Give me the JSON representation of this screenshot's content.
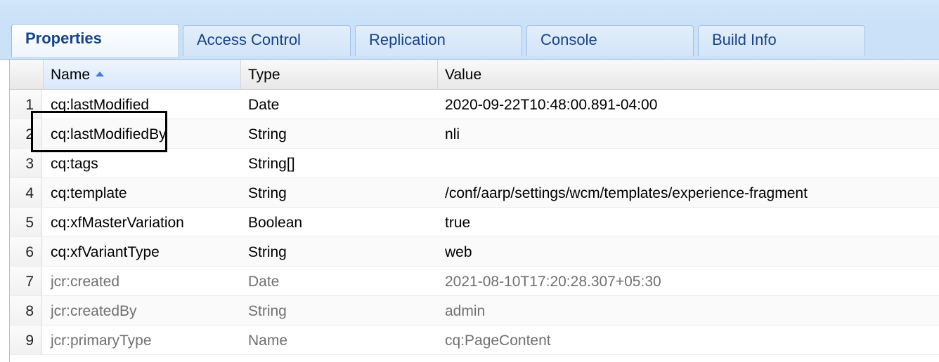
{
  "tabs": [
    {
      "label": "Properties",
      "active": true
    },
    {
      "label": "Access Control",
      "active": false
    },
    {
      "label": "Replication",
      "active": false
    },
    {
      "label": "Console",
      "active": false
    },
    {
      "label": "Build Info",
      "active": false
    }
  ],
  "columns": {
    "name": "Name",
    "type": "Type",
    "value": "Value",
    "sort_column": "Name",
    "sort_direction": "ascending"
  },
  "rows": [
    {
      "num": "1",
      "name": "cq:lastModified",
      "type": "Date",
      "value": "2020-09-22T10:48:00.891-04:00"
    },
    {
      "num": "2",
      "name": "cq:lastModifiedBy",
      "type": "String",
      "value": "nli"
    },
    {
      "num": "3",
      "name": "cq:tags",
      "type": "String[]",
      "value": ""
    },
    {
      "num": "4",
      "name": "cq:template",
      "type": "String",
      "value": "/conf/aarp/settings/wcm/templates/experience-fragment"
    },
    {
      "num": "5",
      "name": "cq:xfMasterVariation",
      "type": "Boolean",
      "value": "true"
    },
    {
      "num": "6",
      "name": "cq:xfVariantType",
      "type": "String",
      "value": "web"
    },
    {
      "num": "7",
      "name": "jcr:created",
      "type": "Date",
      "value": "2021-08-10T17:20:28.307+05:30"
    },
    {
      "num": "8",
      "name": "jcr:createdBy",
      "type": "String",
      "value": "admin"
    },
    {
      "num": "9",
      "name": "jcr:primaryType",
      "type": "Name",
      "value": "cq:PageContent"
    }
  ],
  "colors": {
    "tab_text": "#15428b",
    "system_property_text": "#707070",
    "sort_arrow": "#3f7ed3",
    "highlight_border": "#000000"
  }
}
